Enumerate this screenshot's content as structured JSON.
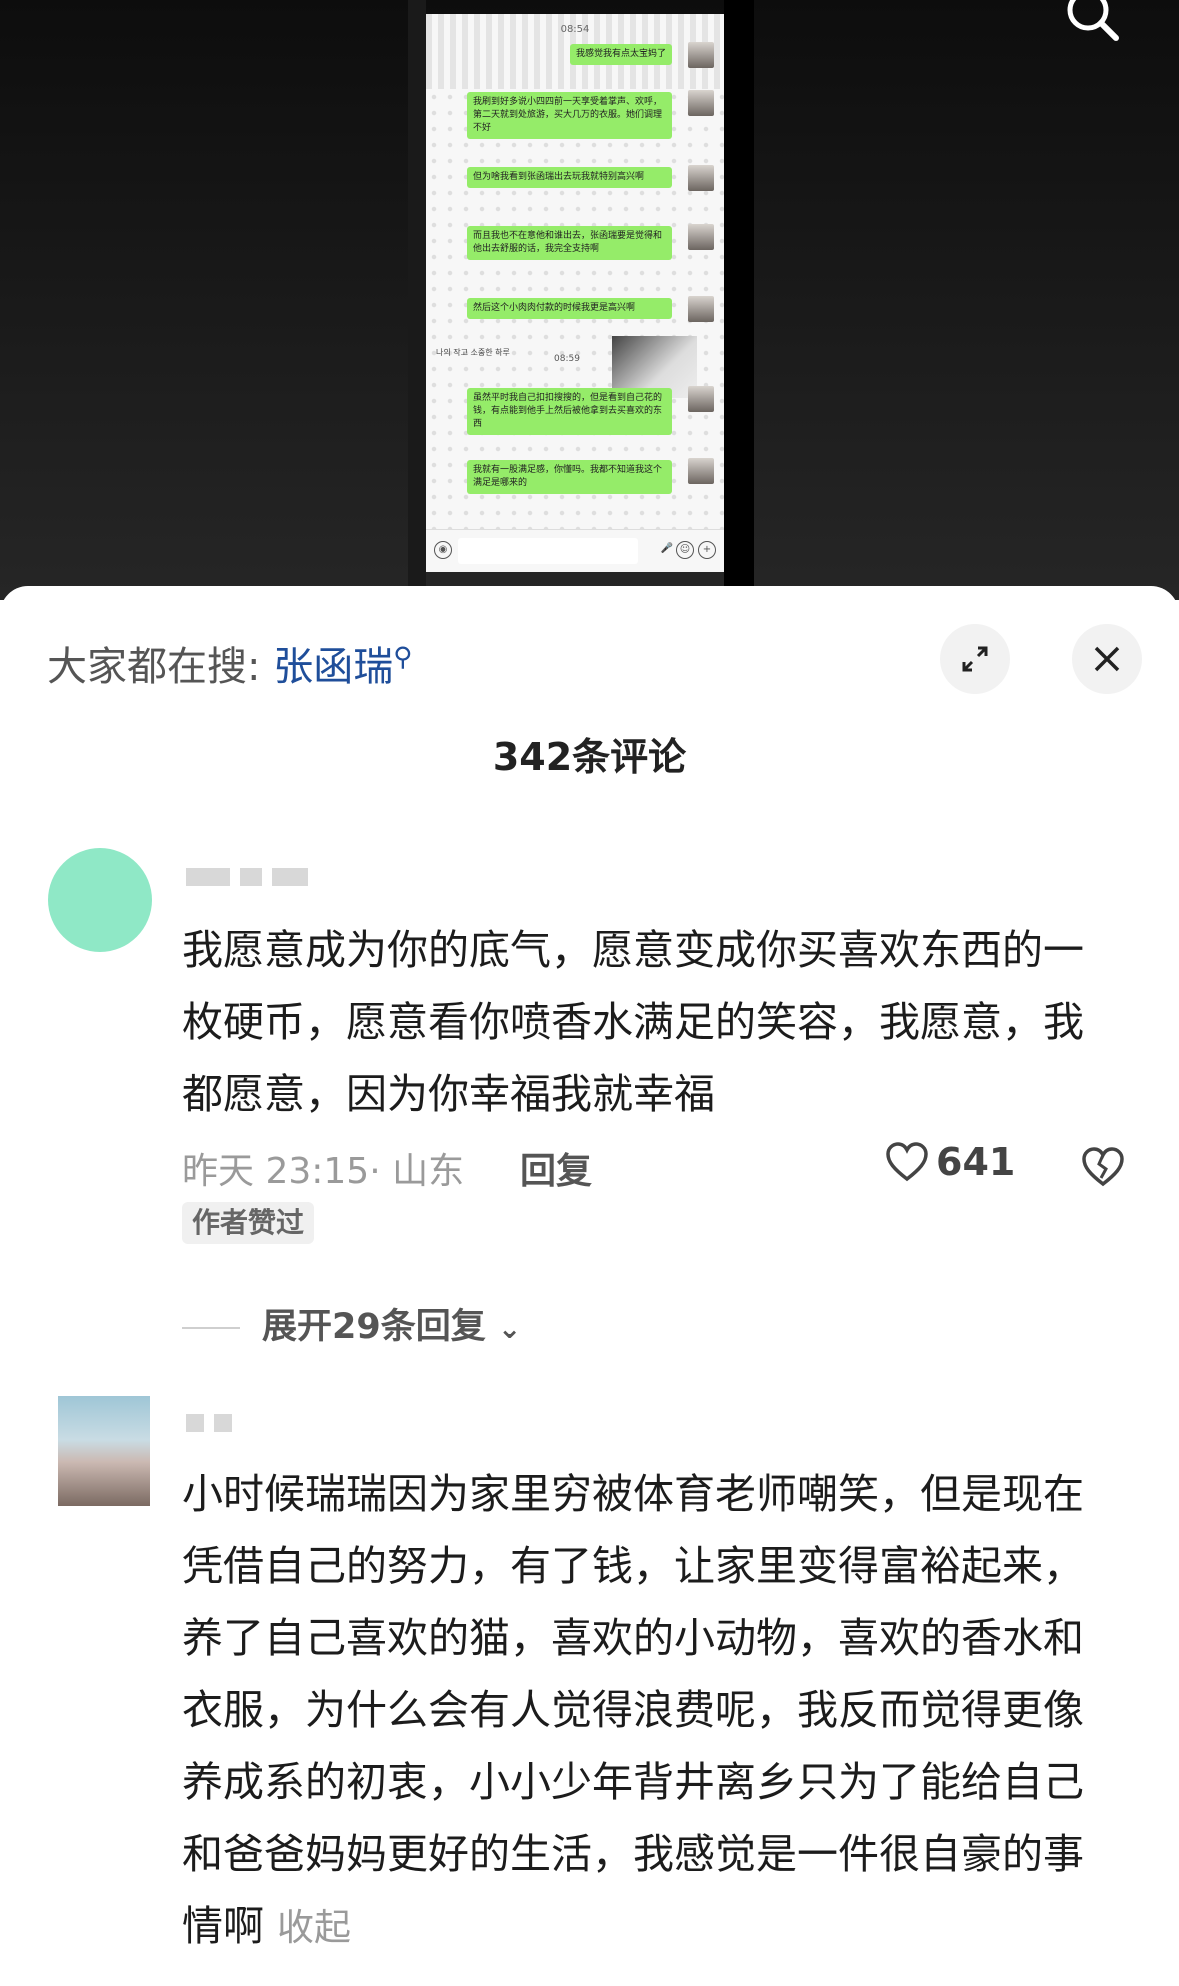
{
  "video": {
    "status_time": "08:54",
    "messages": [
      {
        "text": "我感觉我有点太宝妈了"
      },
      {
        "text": "我刷到好多说小四四前一天享受着掌声、欢呼，第二天就到处旅游，买大几万的衣服。她们调理不好"
      },
      {
        "text": "但为啥我看到张函瑞出去玩我就特别高兴啊"
      },
      {
        "text": "而且我也不在意他和谁出去，张函瑞要是觉得和他出去舒服的话，我完全支持啊"
      },
      {
        "text": "然后这个小肉肉付款的时候我更是高兴啊"
      },
      {
        "text": "虽然平时我自己扣扣搜搜的，但是看到自己花的钱，有点能到他手上然后被他拿到去买喜欢的东西"
      },
      {
        "text": "我就有一股满足感，你懂吗。我都不知道我这个满足是哪来的"
      }
    ],
    "mid_time": "08:59",
    "deco_text": "나의 작고 소중한 하루"
  },
  "sheet": {
    "hot_prefix": "大家都在搜:",
    "hot_keyword": "张函瑞",
    "comment_count": "342条评论"
  },
  "comments": [
    {
      "text": "我愿意成为你的底气，愿意变成你买喜欢东西的一枚硬币，愿意看你喷香水满足的笑容，我愿意，我都愿意，因为你幸福我就幸福",
      "time": "昨天 23:15",
      "location": "· 山东",
      "reply_label": "回复",
      "likes": "641",
      "author_tag": "作者赞过",
      "expand": "展开29条回复"
    },
    {
      "text": "小时候瑞瑞因为家里穷被体育老师嘲笑，但是现在凭借自己的努力，有了钱，让家里变得富裕起来，养了自己喜欢的猫，喜欢的小动物，喜欢的香水和衣服，为什么会有人觉得浪费呢，我反而觉得更像养成系的初衷，小小少年背井离乡只为了能给自己和爸爸妈妈更好的生活，我感觉是一件很自豪的事情啊",
      "collapse": "收起"
    }
  ],
  "colors": {
    "keyword": "#1f4e9a",
    "bubble": "#95ec69"
  },
  "icons": [
    "search-icon",
    "expand-icon",
    "close-icon",
    "heart-icon",
    "dislike-icon",
    "chevron-down-icon"
  ]
}
